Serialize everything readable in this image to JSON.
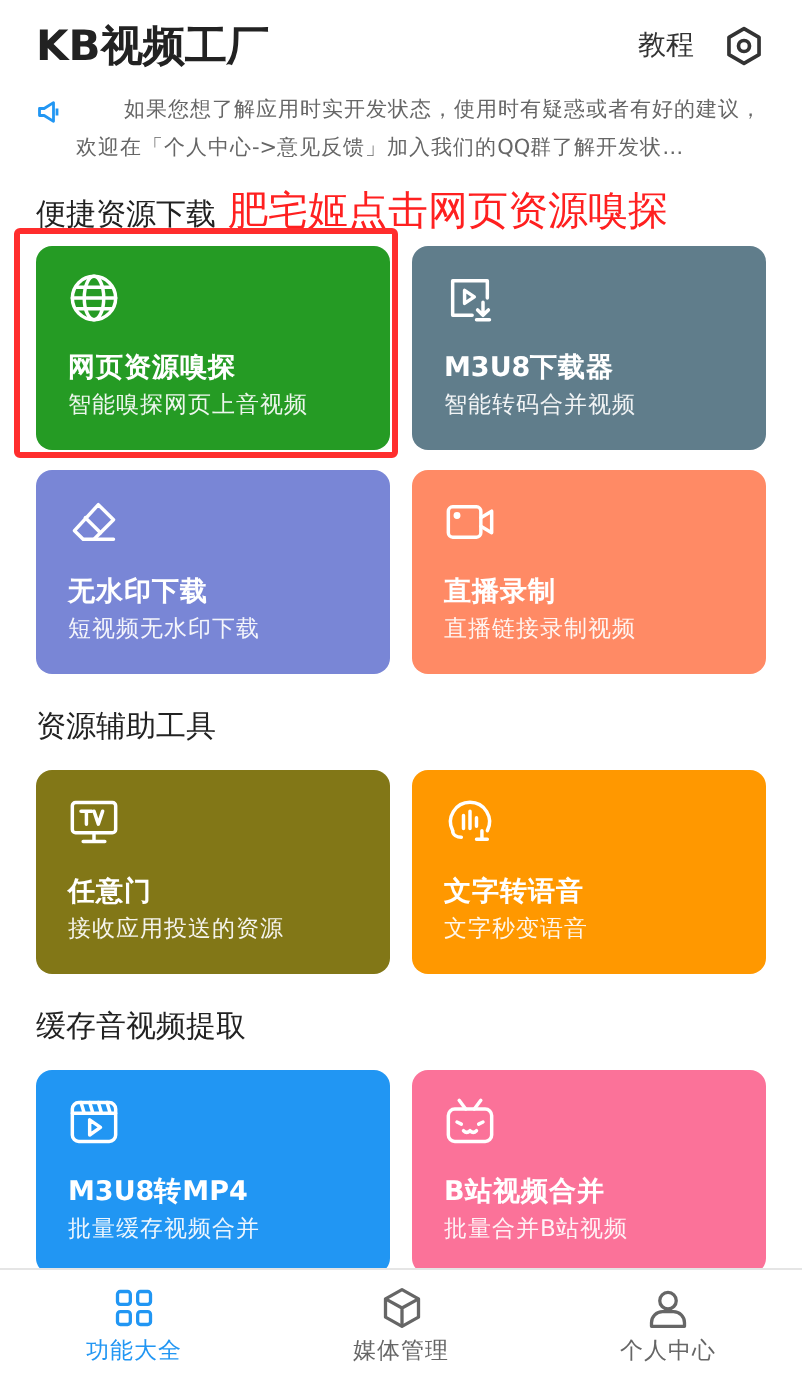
{
  "app_bar": {
    "title": "KB视频工厂",
    "tutorial_link": "教程"
  },
  "notice": "如果您想了解应用时实开发状态，使用时有疑惑或者有好的建议，欢迎在「个人中心->意见反馈」加入我们的QQ群了解开发状…",
  "annotation": {
    "text": "肥宅姬点击网页资源嗅探"
  },
  "sections": [
    {
      "title": "便捷资源下载",
      "cards": [
        {
          "title": "网页资源嗅探",
          "subtitle": "智能嗅探网页上音视频",
          "color": "#259b24",
          "kind": "globe",
          "highlighted": true
        },
        {
          "title": "M3U8下载器",
          "subtitle": "智能转码合并视频",
          "color": "#607d8b",
          "kind": "download"
        },
        {
          "title": "无水印下载",
          "subtitle": "短视频无水印下载",
          "color": "#7986d6",
          "kind": "eraser"
        },
        {
          "title": "直播录制",
          "subtitle": "直播链接录制视频",
          "color": "#ff8a65",
          "kind": "camera"
        }
      ]
    },
    {
      "title": "资源辅助工具",
      "cards": [
        {
          "title": "任意门",
          "subtitle": "接收应用投送的资源",
          "color": "#827717",
          "kind": "tv"
        },
        {
          "title": "文字转语音",
          "subtitle": "文字秒变语音",
          "color": "#ff9800",
          "kind": "voice"
        }
      ]
    },
    {
      "title": "缓存音视频提取",
      "cards": [
        {
          "title": "M3U8转MP4",
          "subtitle": "批量缓存视频合并",
          "color": "#2196f3",
          "kind": "film"
        },
        {
          "title": "B站视频合并",
          "subtitle": "批量合并B站视频",
          "color": "#fb7299",
          "kind": "tvface"
        }
      ]
    }
  ],
  "bottom_nav": [
    {
      "label": "功能大全",
      "selected": true,
      "kind": "grid"
    },
    {
      "label": "媒体管理",
      "selected": false,
      "kind": "box"
    },
    {
      "label": "个人中心",
      "selected": false,
      "kind": "person"
    }
  ]
}
